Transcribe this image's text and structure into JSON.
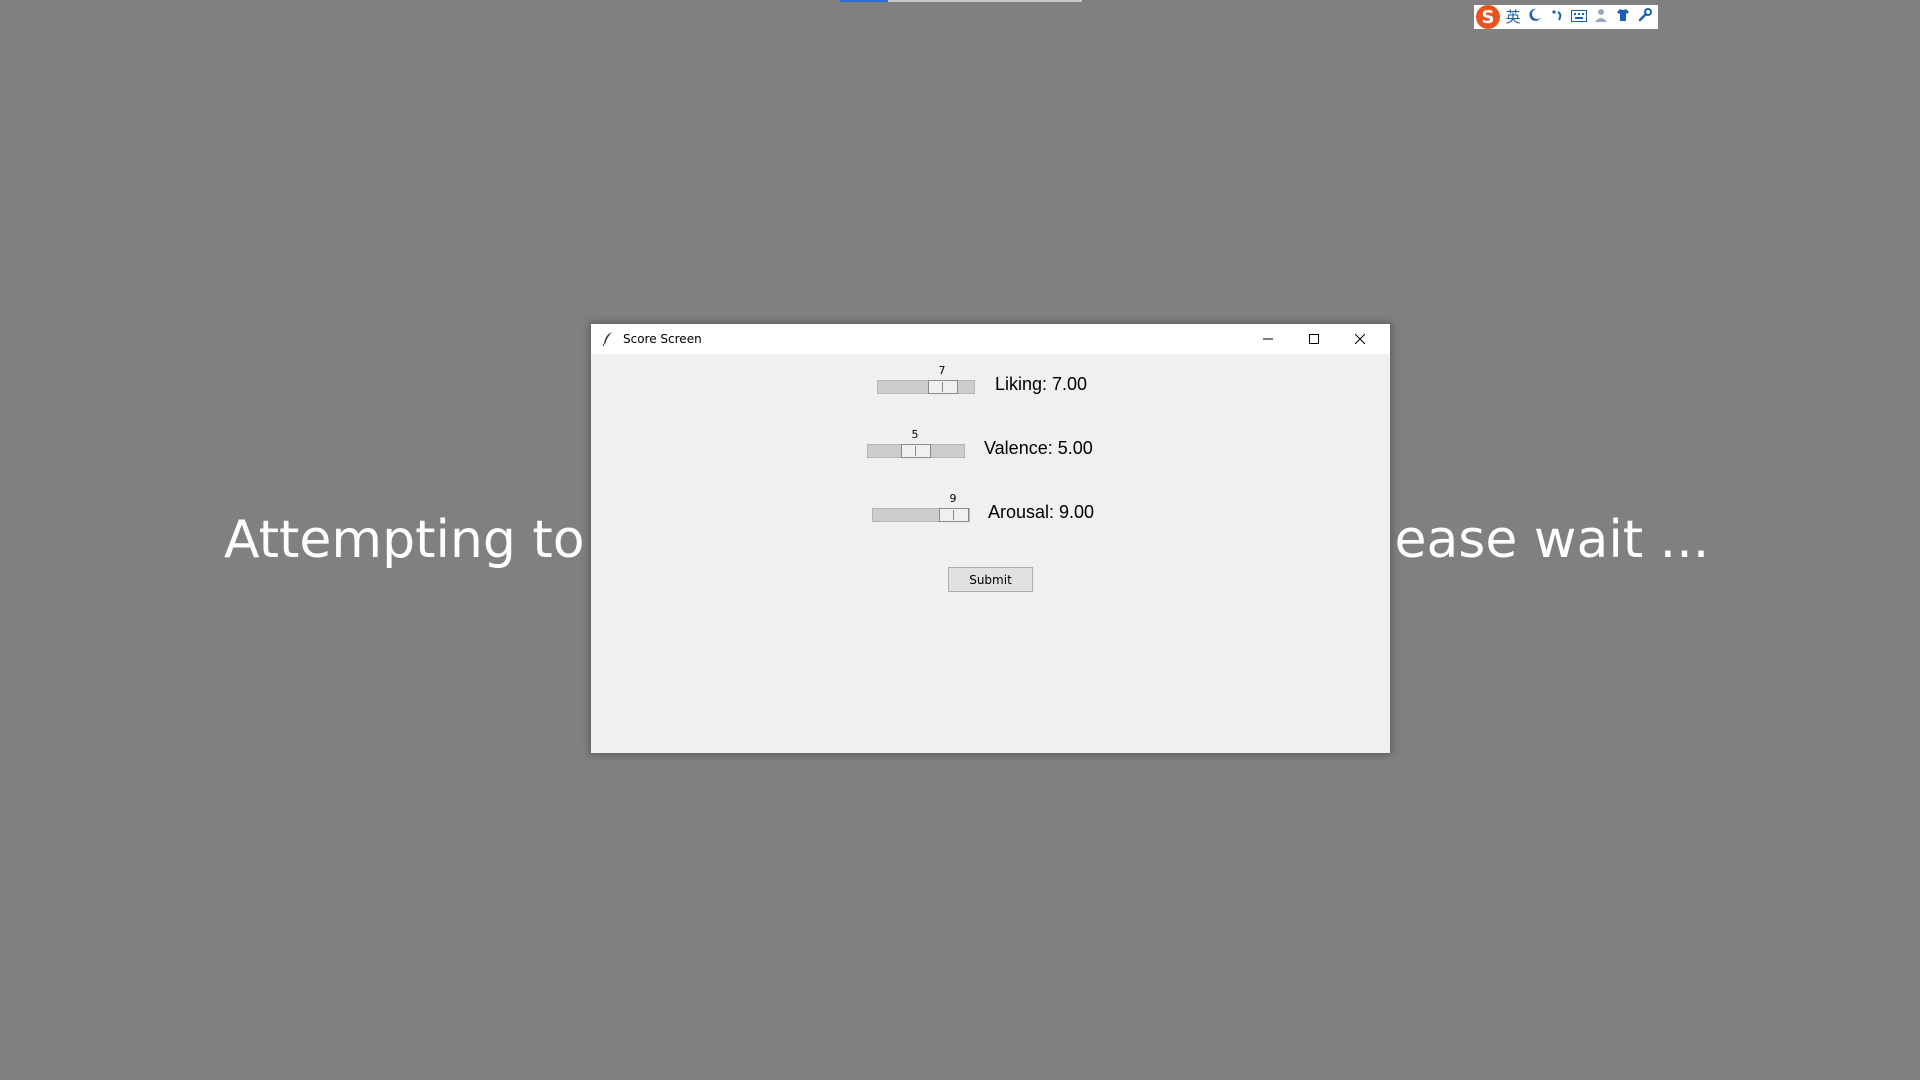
{
  "background": {
    "message_left": "Attempting to",
    "message_right": "lease wait ..."
  },
  "ime_toolbar": {
    "logo": "S",
    "language": "英",
    "icons": [
      "moon-icon",
      "punctuation-icon",
      "keyboard-icon",
      "person-icon",
      "shirt-icon",
      "wrench-icon"
    ]
  },
  "window": {
    "title": "Score Screen",
    "icons": [
      "feather-icon",
      "minimize-icon",
      "maximize-icon",
      "close-icon"
    ]
  },
  "sliders": [
    {
      "name": "Liking",
      "value": "7",
      "label": "Liking: 7.00",
      "min": 1,
      "max": 9,
      "level": 7
    },
    {
      "name": "Valence",
      "value": "5",
      "label": "Valence: 5.00",
      "min": 1,
      "max": 9,
      "level": 5
    },
    {
      "name": "Arousal",
      "value": "9",
      "label": "Arousal: 9.00",
      "min": 1,
      "max": 9,
      "level": 9
    }
  ],
  "submit_label": "Submit",
  "colors": {
    "desktop": "#808080",
    "window_bg": "#f0f0f0",
    "ime_brand": "#e8541d",
    "ime_icons": "#1a5fb4",
    "progress_accent": "#2f6dd0"
  }
}
